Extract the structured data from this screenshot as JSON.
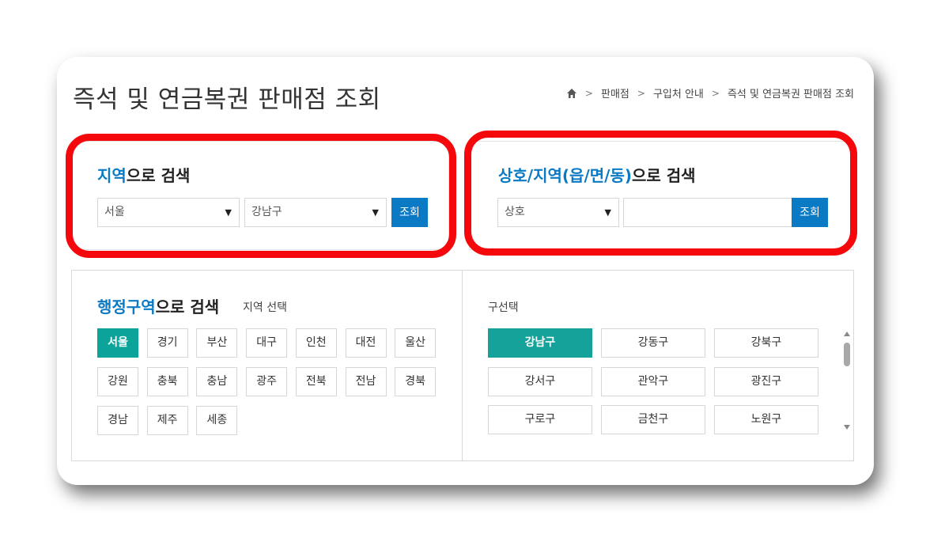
{
  "page": {
    "title": "즉석 및 연금복권 판매점 조회"
  },
  "breadcrumb": {
    "home_icon": "home-icon",
    "items": [
      "판매점",
      "구입처 안내",
      "즉석 및 연금복권 판매점 조회"
    ]
  },
  "region_search": {
    "heading_accent": "지역",
    "heading_rest": "으로 검색",
    "city_select": "서울",
    "district_select": "강남구",
    "button": "조회"
  },
  "name_search": {
    "heading_accent": "상호/지역(읍/면/동)",
    "heading_rest": "으로 검색",
    "type_select": "상호",
    "input_value": "",
    "button": "조회"
  },
  "admin_search": {
    "heading_accent": "행정구역",
    "heading_rest": "으로 검색",
    "region_label": "지역 선택",
    "regions": [
      "서울",
      "경기",
      "부산",
      "대구",
      "인천",
      "대전",
      "울산",
      "강원",
      "충북",
      "충남",
      "광주",
      "전북",
      "전남",
      "경북",
      "경남",
      "제주",
      "세종"
    ],
    "selected_region": "서울",
    "district_label": "구선택",
    "districts": [
      "강남구",
      "강동구",
      "강북구",
      "강서구",
      "관악구",
      "광진구",
      "구로구",
      "금천구",
      "노원구"
    ],
    "selected_district": "강남구"
  },
  "colors": {
    "accent_blue": "#0a7ac4",
    "active_teal": "#0ca39b",
    "highlight_red": "#f4080c"
  }
}
